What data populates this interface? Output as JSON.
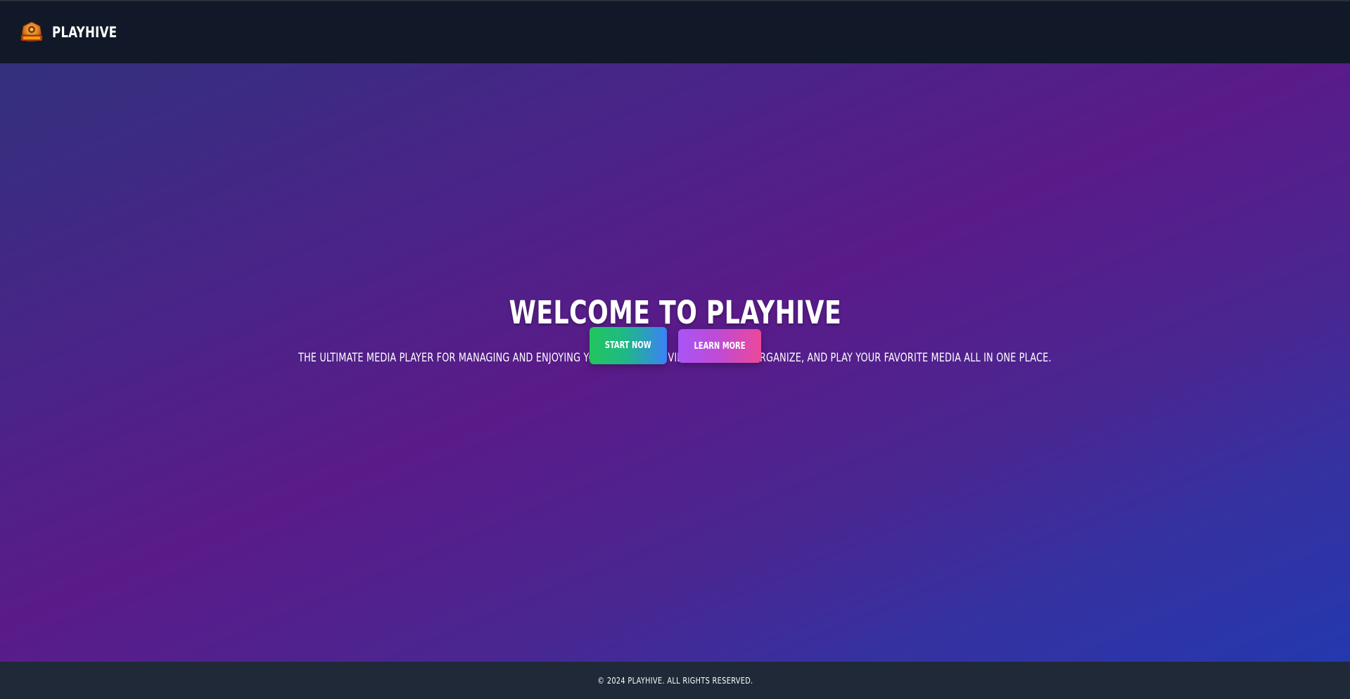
{
  "header": {
    "brand": "PLAYHIVE",
    "logo_icon": "playhive-logo-icon",
    "background": "#111827"
  },
  "hero": {
    "title": "WELCOME TO PLAYHIVE",
    "subtitle": "THE ULTIMATE MEDIA PLAYER FOR MANAGING AND ENJOYING YOUR MUSIC AND VIDEOS. UPLOAD, ORGANIZE, AND PLAY YOUR FAVORITE MEDIA ALL IN ONE PLACE.",
    "gradient_colors": [
      "#33307e",
      "#5a1b89",
      "#2438ae"
    ]
  },
  "buttons": {
    "start_label": "START NOW",
    "learn_label": "LEARN MORE",
    "start_colors": [
      "#22c55e",
      "#3b82f6"
    ],
    "learn_colors": [
      "#a855f7",
      "#ec4899"
    ]
  },
  "footer": {
    "copyright": "© 2024 PLAYHIVE. ALL RIGHTS RESERVED.",
    "background": "#1f2937"
  }
}
